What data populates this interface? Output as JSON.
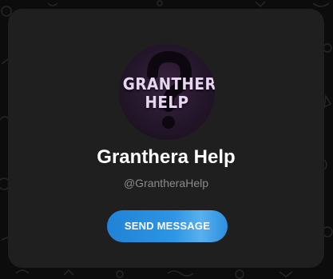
{
  "profile": {
    "avatar_line1": "GRANTHERA",
    "avatar_line2": "HELP",
    "name": "Granthera Help",
    "handle": "@GrantheraHelp"
  },
  "actions": {
    "send_label": "SEND MESSAGE"
  },
  "colors": {
    "page_background": "#0c0c0c",
    "card_background": "#1f1f1f",
    "button_accent": "#2c95e4",
    "avatar_background": "#24162a"
  },
  "icons": {
    "avatar_glyph": "question-mark-icon"
  }
}
